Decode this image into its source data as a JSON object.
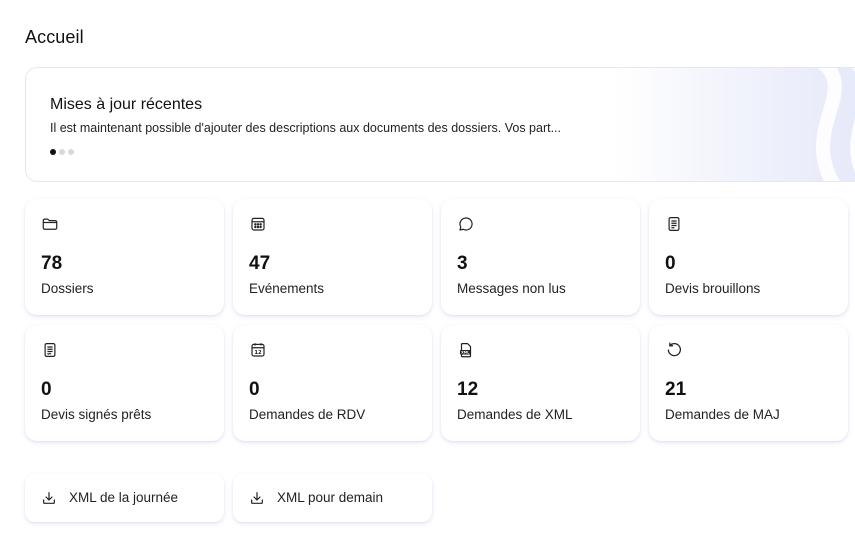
{
  "page": {
    "title": "Accueil"
  },
  "updates": {
    "title": "Mises à jour récentes",
    "text": "Il est maintenant possible d'ajouter des descriptions aux documents des dossiers. Vos part...",
    "slide_count": 3,
    "active_slide": 1
  },
  "stats": [
    {
      "icon": "folder-icon",
      "value": "78",
      "label": "Dossiers"
    },
    {
      "icon": "calendar-icon",
      "value": "47",
      "label": "Evénements"
    },
    {
      "icon": "chat-bubble-icon",
      "value": "3",
      "label": "Messages non lus"
    },
    {
      "icon": "document-icon",
      "value": "0",
      "label": "Devis brouillons"
    },
    {
      "icon": "document-signed-icon",
      "value": "0",
      "label": "Devis signés prêts"
    },
    {
      "icon": "calendar-day-icon",
      "value": "0",
      "label": "Demandes de RDV"
    },
    {
      "icon": "xml-file-icon",
      "value": "12",
      "label": "Demandes de XML"
    },
    {
      "icon": "refresh-icon",
      "value": "21",
      "label": "Demandes de MAJ"
    }
  ],
  "actions": [
    {
      "icon": "download-icon",
      "label": "XML de la journée"
    },
    {
      "icon": "download-icon",
      "label": "XML pour demain"
    }
  ],
  "colors": {
    "accent_gradient": "#e6e9fa",
    "card_shadow": "#6478c8",
    "border": "#e6e8ee",
    "dot_active": "#111111",
    "dot_inactive": "#d7d9de"
  }
}
